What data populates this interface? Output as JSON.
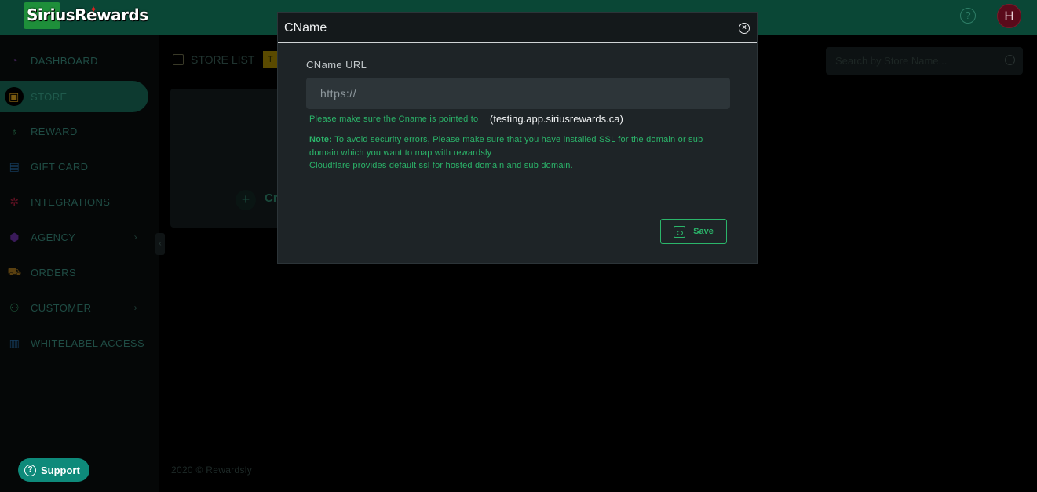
{
  "brand": {
    "name": "SiriusRewards"
  },
  "header": {
    "help_icon": "question-circle-icon",
    "avatar_initial": "H"
  },
  "sidebar": {
    "items": [
      {
        "label": "DASHBOARD",
        "icon": "dashboard-icon",
        "color": "#3b1f4c"
      },
      {
        "label": "STORE",
        "icon": "store-icon",
        "color": "#7a5a10",
        "active": true
      },
      {
        "label": "REWARD",
        "icon": "reward-icon",
        "color": "#1f5a3c"
      },
      {
        "label": "GIFT CARD",
        "icon": "gift-card-icon",
        "color": "#153a5a"
      },
      {
        "label": "INTEGRATIONS",
        "icon": "integrations-icon",
        "color": "#5a1020"
      },
      {
        "label": "AGENCY",
        "icon": "agency-icon",
        "color": "#3a1a5a",
        "has_chevron": true
      },
      {
        "label": "ORDERS",
        "icon": "cart-icon",
        "color": "#5a4010"
      },
      {
        "label": "CUSTOMER",
        "icon": "customer-icon",
        "color": "#1f5a3c",
        "has_chevron": true
      },
      {
        "label": "WHITELABEL ACCESS",
        "icon": "whitelabel-icon",
        "color": "#153a5a"
      }
    ],
    "support_label": "Support"
  },
  "main": {
    "store_list_title": "STORE LIST",
    "tag_text": "T",
    "create_label": "Cr",
    "search_placeholder": "Search by Store Name...",
    "footer": "2020 © Rewardsly"
  },
  "modal": {
    "title": "CName",
    "field_label": "CName URL",
    "input_value": "",
    "input_placeholder": "https://",
    "hint_text": "Please make sure the Cname is pointed to",
    "hint_target": "(testing.app.siriusrewards.ca)",
    "note_label": "Note:",
    "note_text": "To avoid security errors, Please make sure that you have installed SSL for the domain or sub domain which you want to map with rewardsly",
    "note_line2": "Cloudflare provides default ssl for hosted domain and sub domain.",
    "save_label": "Save"
  },
  "colors": {
    "accent": "#2bb56a",
    "header_bg": "#0a4736",
    "modal_bg": "#1e2427"
  }
}
